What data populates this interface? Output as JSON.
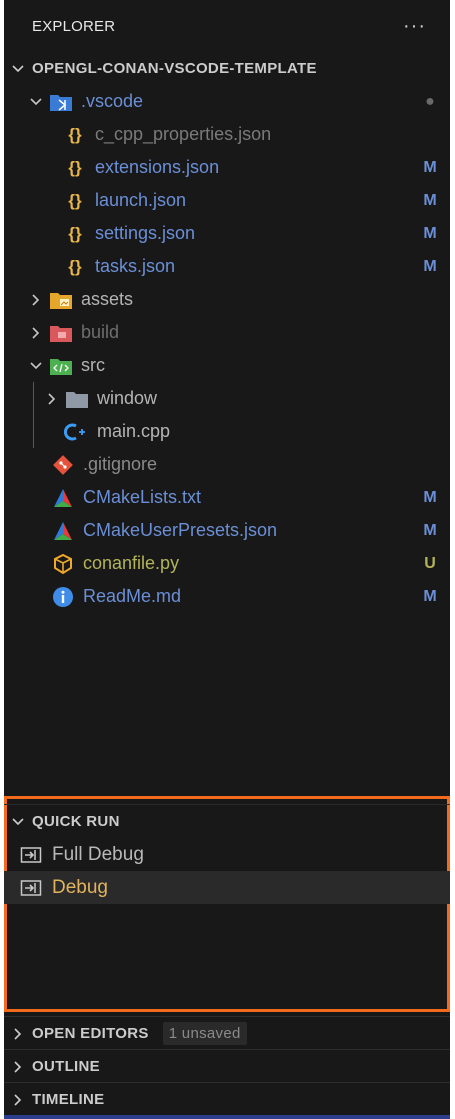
{
  "explorer": {
    "title": "EXPLORER",
    "more_icon": "···",
    "root_folder": "OPENGL-CONAN-VSCODE-TEMPLATE",
    "items": [
      {
        "name": ".vscode",
        "icon": "vscode-folder-icon",
        "badge": "●"
      },
      {
        "name": "c_cpp_properties.json",
        "icon": "json-braces-icon",
        "badge": ""
      },
      {
        "name": "extensions.json",
        "icon": "json-braces-icon",
        "badge": "M"
      },
      {
        "name": "launch.json",
        "icon": "json-braces-icon",
        "badge": "M"
      },
      {
        "name": "settings.json",
        "icon": "json-braces-icon",
        "badge": "M"
      },
      {
        "name": "tasks.json",
        "icon": "json-braces-icon",
        "badge": "M"
      },
      {
        "name": "assets",
        "icon": "assets-folder-icon",
        "badge": ""
      },
      {
        "name": "build",
        "icon": "build-folder-icon",
        "badge": ""
      },
      {
        "name": "src",
        "icon": "src-folder-icon",
        "badge": ""
      },
      {
        "name": "window",
        "icon": "folder-icon",
        "badge": ""
      },
      {
        "name": "main.cpp",
        "icon": "cpp-icon",
        "badge": ""
      },
      {
        "name": ".gitignore",
        "icon": "git-icon",
        "badge": ""
      },
      {
        "name": "CMakeLists.txt",
        "icon": "cmake-icon",
        "badge": "M"
      },
      {
        "name": "CMakeUserPresets.json",
        "icon": "cmake-icon",
        "badge": "M"
      },
      {
        "name": "conanfile.py",
        "icon": "conan-icon",
        "badge": "U"
      },
      {
        "name": "ReadMe.md",
        "icon": "info-icon",
        "badge": "M"
      }
    ]
  },
  "quick_run": {
    "title": "QUICK RUN",
    "items": [
      {
        "label": "Full Debug",
        "icon": "run-task-icon"
      },
      {
        "label": "Debug",
        "icon": "run-task-icon"
      }
    ]
  },
  "open_editors": {
    "title": "OPEN EDITORS",
    "pill": "1 unsaved"
  },
  "outline": {
    "title": "OUTLINE"
  },
  "timeline": {
    "title": "TIMELINE"
  },
  "colors": {
    "sidebar_bg": "#181818",
    "modified": "#6b8fd6",
    "untracked": "#b3b35a",
    "highlight_border": "#f26a1b",
    "selected_label": "#e2b35c"
  }
}
